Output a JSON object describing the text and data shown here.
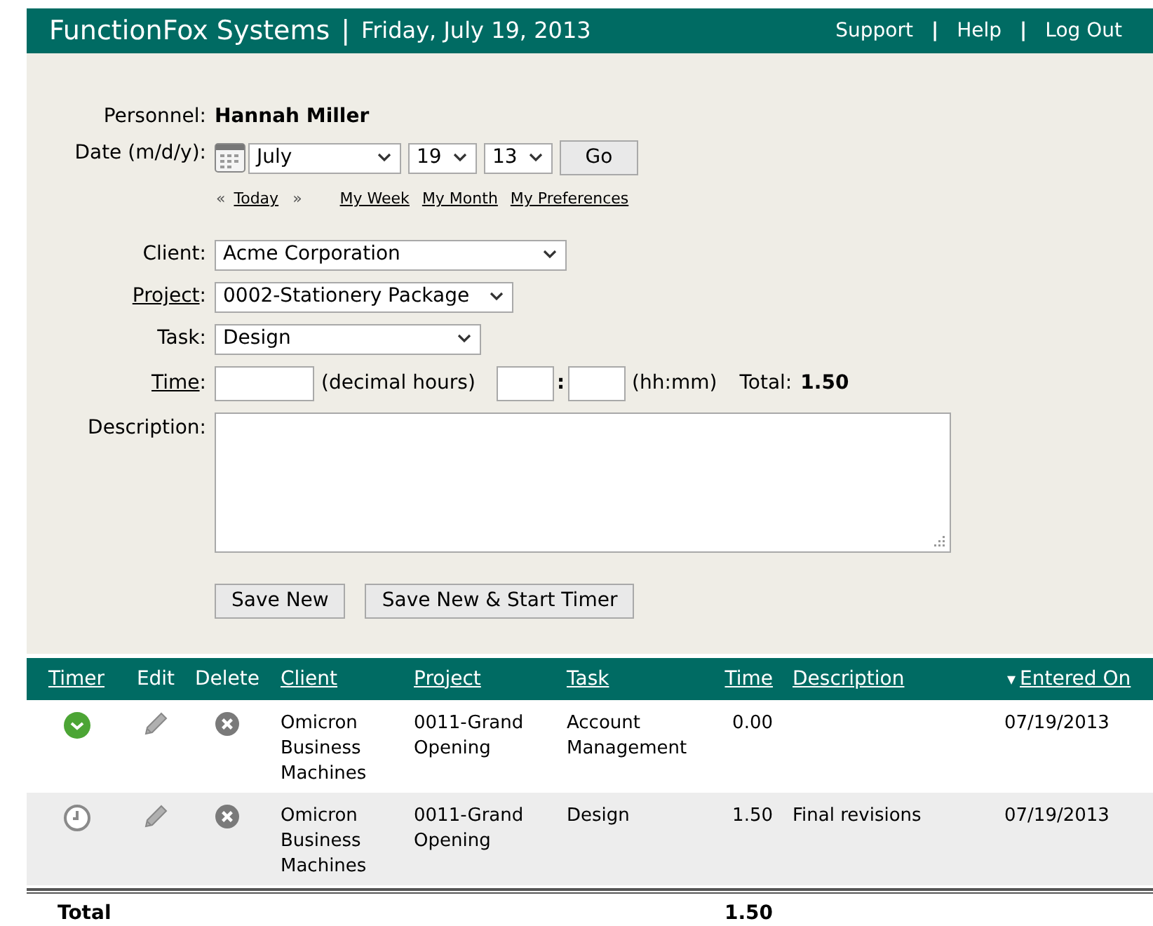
{
  "header": {
    "title": "FunctionFox Systems",
    "separator": "|",
    "date": "Friday, July 19, 2013",
    "links": [
      {
        "label": "Support"
      },
      {
        "label": "Help",
        "separator": "|"
      },
      {
        "label": "Log Out",
        "separator": "|"
      }
    ]
  },
  "form": {
    "personnel_label": "Personnel:",
    "personnel": "Hannah Miller",
    "date_label": "Date (m/d/y):",
    "month": "July",
    "day": "19",
    "year": "13",
    "go": "Go",
    "nav": {
      "prev": "«",
      "today": "Today",
      "next": "»",
      "links": [
        "My Week",
        "My Month",
        "My Preferences"
      ]
    },
    "fields": [
      {
        "kind": "select",
        "label": "Client:",
        "link": false,
        "value": "Acme Corporation"
      },
      {
        "kind": "select",
        "label": "Project",
        "suffix": ":",
        "link": true,
        "value": "0002-Stationery Package"
      },
      {
        "kind": "select",
        "label": "Task:",
        "link": false,
        "value": "Design"
      }
    ],
    "time": {
      "label": "Time",
      "suffix": ":",
      "link": true,
      "decimal_hint": "(decimal hours)",
      "colon": ":",
      "hhmm_hint": "(hh:mm)",
      "total_label": "Total:",
      "total": "1.50"
    },
    "description_label": "Description:",
    "buttons": [
      "Save New",
      "Save New & Start Timer"
    ]
  },
  "table": {
    "columns": [
      {
        "label": "Timer",
        "link": true
      },
      {
        "label": "Edit",
        "link": false
      },
      {
        "label": "Delete",
        "link": false
      },
      {
        "label": "Client",
        "link": true
      },
      {
        "label": "Project",
        "link": true
      },
      {
        "label": "Task",
        "link": true
      },
      {
        "label": "Time",
        "link": true
      },
      {
        "label": "Description",
        "link": true
      },
      {
        "label": "Entered On",
        "link": true,
        "sort_arrow": "▾"
      }
    ],
    "rows": [
      {
        "timer_running": true,
        "client": "Omicron Business Machines",
        "project": "0011-Grand Opening",
        "task": "Account Management",
        "time": "0.00",
        "description": "",
        "entered_on": "07/19/2013"
      },
      {
        "timer_running": false,
        "client": "Omicron Business Machines",
        "project": "0011-Grand Opening",
        "task": "Design",
        "time": "1.50",
        "description": "Final revisions",
        "entered_on": "07/19/2013"
      }
    ],
    "total_label": "Total",
    "total": "1.50"
  }
}
